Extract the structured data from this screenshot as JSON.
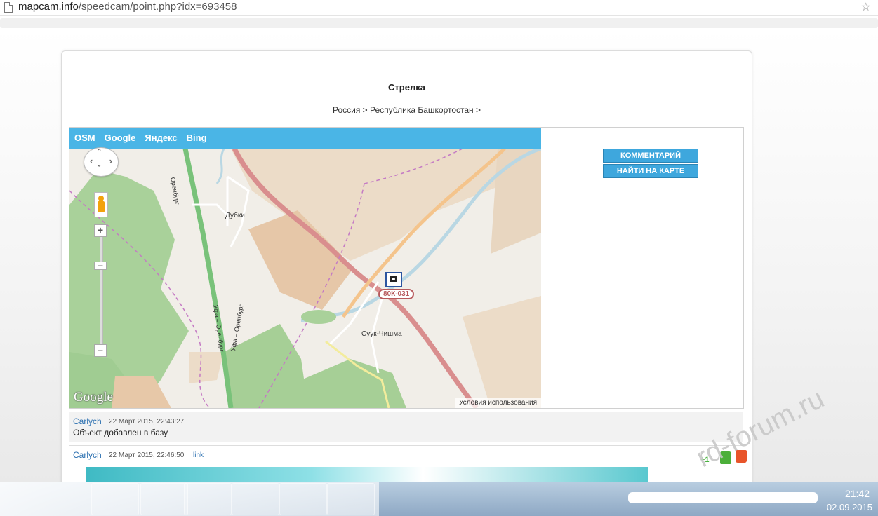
{
  "browser": {
    "url_host": "mapcam.info",
    "url_path": "/speedcam/point.php?idx=693458"
  },
  "page": {
    "title": "Стрелка",
    "breadcrumb": "Россия > Республика Башкортостан >"
  },
  "map": {
    "tabs": [
      "OSM",
      "Google",
      "Яндекс",
      "Bing"
    ],
    "places": [
      "Дубки",
      "Суук-Чишма"
    ],
    "road_labels": [
      "Оренбург",
      "Уфа – Оренбург",
      "Уфа – Оренбург"
    ],
    "camera_code": "80К-031",
    "provider_logo": "Google",
    "terms": "Условия использования",
    "icons": [
      "pan-control-icon",
      "pegman-icon",
      "zoom-in-icon",
      "zoom-out-icon",
      "camera-icon"
    ]
  },
  "actions": {
    "comments": "КОММЕНТАРИЙ",
    "find_on_map": "НАЙТИ НА КАРТЕ"
  },
  "comments": [
    {
      "author": "Carlych",
      "date": "22 Март 2015, 22:43:27",
      "text": "Объект добавлен в базу"
    },
    {
      "author": "Carlych",
      "date": "22 Март 2015, 22:46:50",
      "link": "link",
      "score": "+1"
    }
  ],
  "taskbar": {
    "time": "21:42",
    "date": "02.09.2015"
  },
  "watermark": "rd-forum.ru"
}
